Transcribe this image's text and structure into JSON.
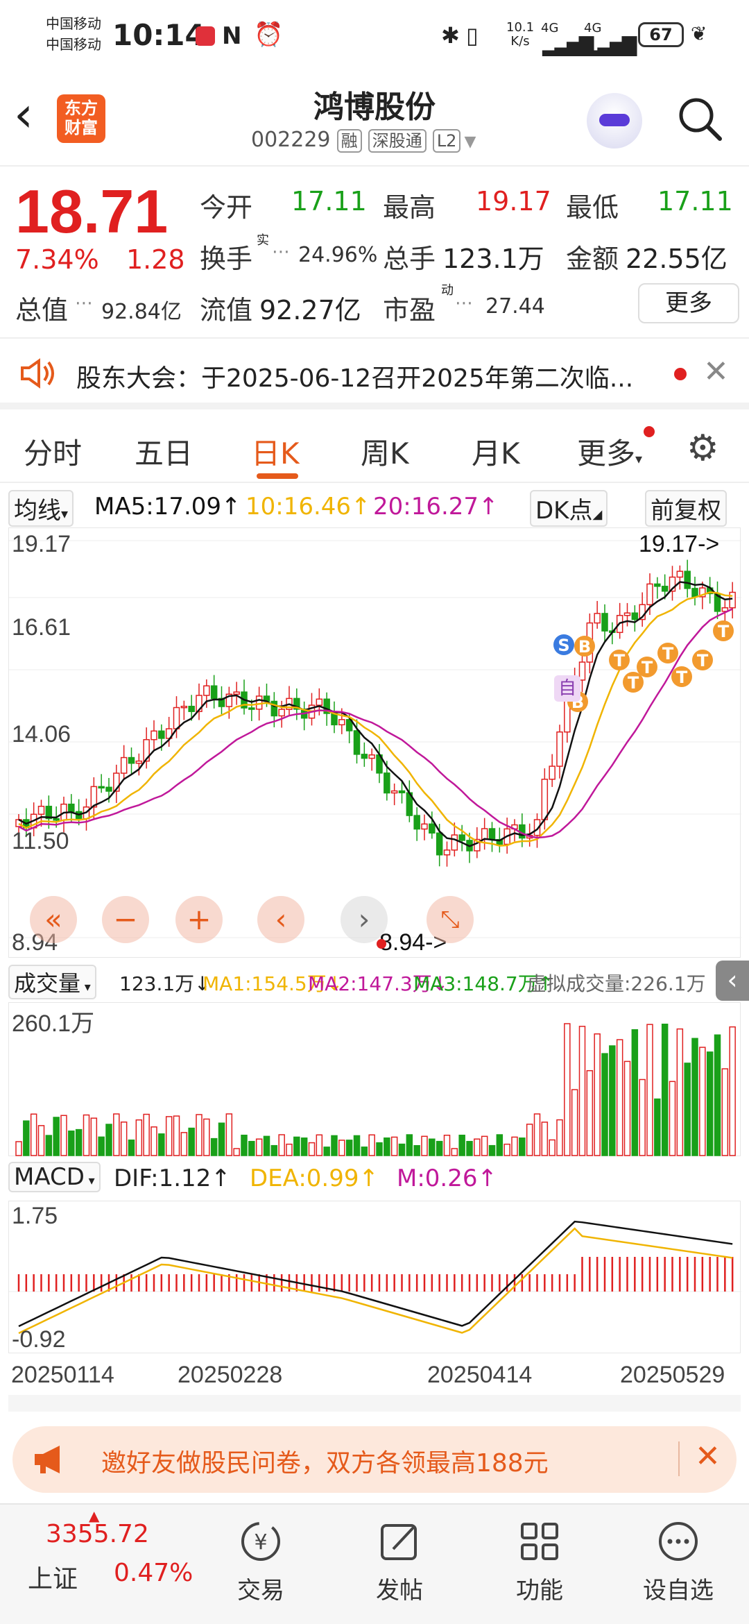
{
  "status_bar": {
    "carrier1": "中国移动",
    "carrier2": "中国移动",
    "time": "10:14",
    "net_speed_value": "10.1",
    "net_speed_unit": "K/s",
    "signal1": "4G",
    "signal2": "4G",
    "battery": "67"
  },
  "header": {
    "logo_line1": "东方",
    "logo_line2": "财富",
    "stock_name": "鸿博股份",
    "stock_code": "002229",
    "tags": [
      "融",
      "深股通",
      "L2"
    ]
  },
  "quote": {
    "price": "18.71",
    "change_pct": "7.34%",
    "change_amt": "1.28",
    "open_label": "今开",
    "open_value": "17.11",
    "high_label": "最高",
    "high_value": "19.17",
    "low_label": "最低",
    "low_value": "17.11",
    "turnover_label": "换手",
    "turnover_sup": "实",
    "turnover_value": "24.96%",
    "volume_label": "总手",
    "volume_value": "123.1万",
    "amount_label": "金额",
    "amount_value": "22.55亿",
    "total_mv_label": "总值",
    "total_mv_value": "92.84亿",
    "float_mv_label": "流值",
    "float_mv_value": "92.27亿",
    "pe_label": "市盈",
    "pe_sup": "动",
    "pe_value": "27.44",
    "more_label": "更多"
  },
  "notice": {
    "text": "股东大会：于2025-06-12召开2025年第二次临..."
  },
  "tabs": [
    "分时",
    "五日",
    "日K",
    "周K",
    "月K",
    "更多"
  ],
  "active_tab": "日K",
  "kline_indicators": {
    "ma_selector": "均线",
    "ma5": "MA5:17.09",
    "ma10": "10:16.46",
    "ma20": "20:16.27",
    "dk_label": "DK点",
    "adjust_label": "前复权"
  },
  "volume_indicators": {
    "selector": "成交量",
    "vol": "123.1万",
    "ma1": "MA1:154.5万",
    "ma2": "MA2:147.3万",
    "ma3": "MA3:148.7万",
    "virtual": "虚拟成交量:226.1万",
    "max_label": "260.1万"
  },
  "macd_indicators": {
    "selector": "MACD",
    "dif": "DIF:1.12",
    "dea": "DEA:0.99",
    "m": "M:0.26",
    "max_label": "1.75",
    "min_label": "-0.92"
  },
  "price_axis": {
    "labels": [
      "19.17",
      "16.61",
      "14.06",
      "11.50",
      "8.94"
    ],
    "max_marker": "19.17->",
    "min_marker": "8.94->"
  },
  "date_axis": [
    "20250114",
    "20250228",
    "20250414",
    "20250529"
  ],
  "markers": {
    "zi": "自",
    "s": "S",
    "b": "B",
    "t": "T"
  },
  "banner": {
    "text": "邀好友做股民问卷，双方各领最高188元"
  },
  "bottom_nav": {
    "index_value": "3355.72",
    "index_name": "上证",
    "index_change": "0.47%",
    "items": [
      "交易",
      "发帖",
      "功能",
      "设自选"
    ]
  },
  "colors": {
    "up": "#e02020",
    "down": "#19a019",
    "accent": "#e55a1b",
    "ma5": "#111111",
    "ma10": "#f0b400",
    "ma20": "#c0189a"
  }
}
